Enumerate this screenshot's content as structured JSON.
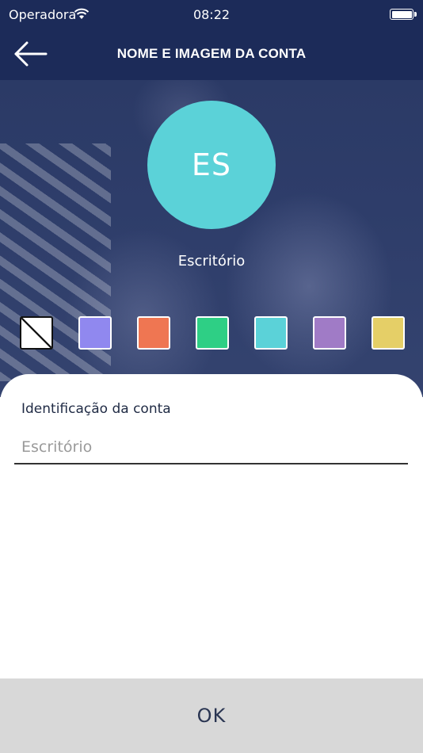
{
  "status_bar": {
    "carrier": "Operadora",
    "time": "08:22",
    "icons": [
      "wifi-icon",
      "battery-icon"
    ]
  },
  "nav": {
    "title": "NOME E IMAGEM DA CONTA",
    "back_icon": "arrow-left-icon"
  },
  "avatar": {
    "initials": "ES",
    "color": "#5bd2d8"
  },
  "account_name": "Escritório",
  "color_options": [
    {
      "name": "none",
      "color": "#ffffff"
    },
    {
      "name": "periwinkle",
      "color": "#9088ef"
    },
    {
      "name": "orange",
      "color": "#ef7652"
    },
    {
      "name": "green",
      "color": "#2ecf85"
    },
    {
      "name": "cyan",
      "color": "#5bd2d8"
    },
    {
      "name": "purple",
      "color": "#a07bc6"
    },
    {
      "name": "yellow",
      "color": "#e5cf67"
    }
  ],
  "form": {
    "label": "Identificação da conta",
    "placeholder": "Escritório",
    "value": ""
  },
  "ok_button": "OK",
  "colors": {
    "header_bg": "#1c2b59",
    "ok_bg": "#d8d8d8"
  }
}
